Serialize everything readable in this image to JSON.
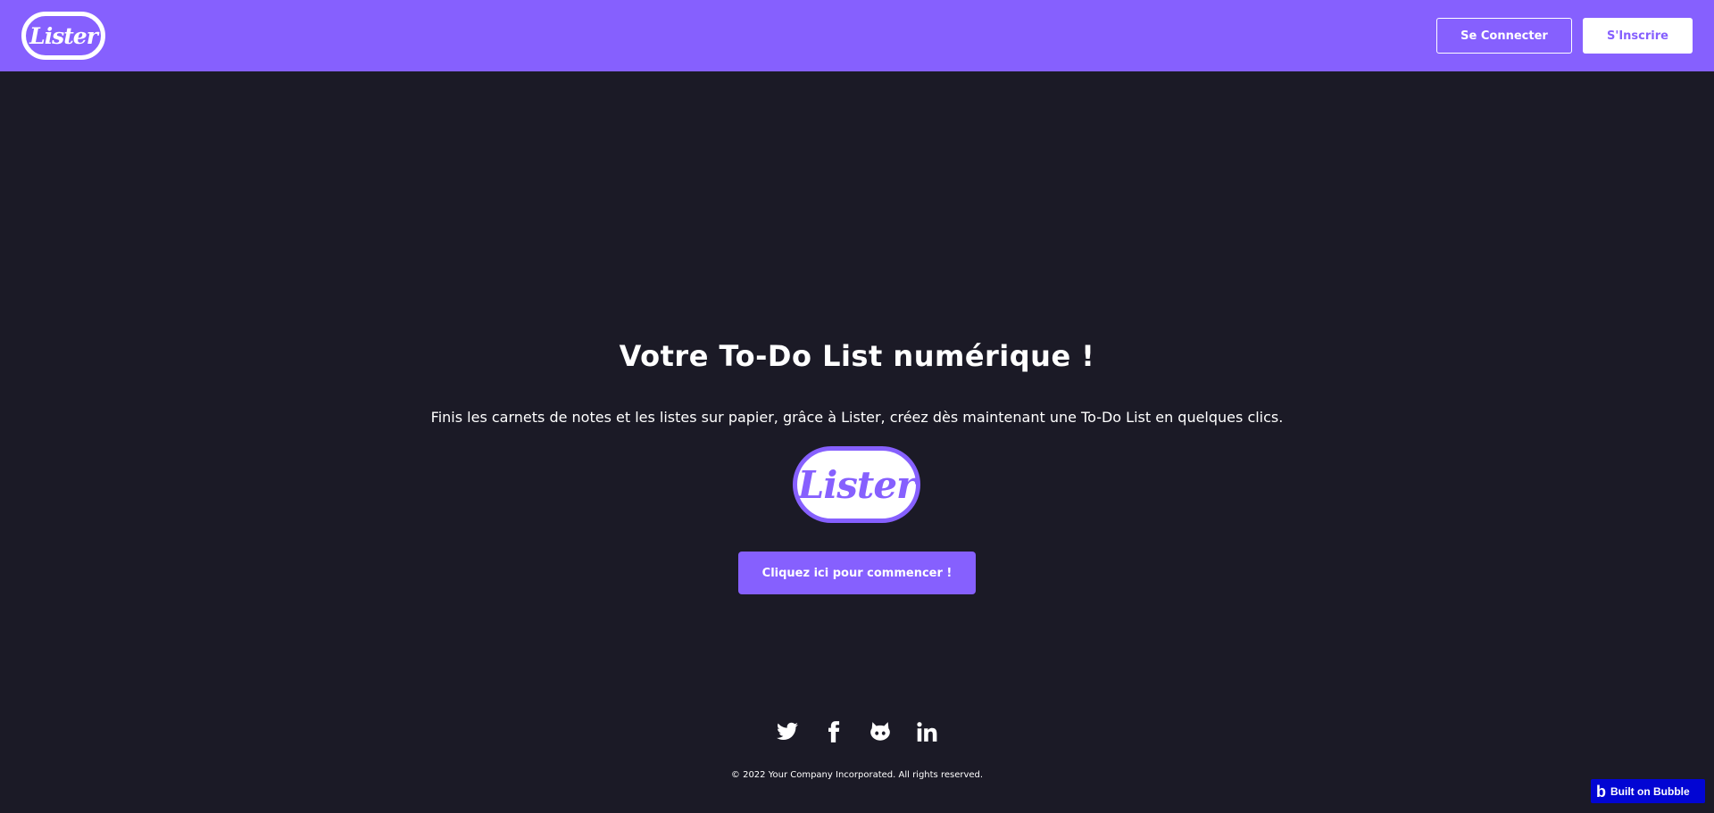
{
  "header": {
    "logo_text": "Lister",
    "login_label": "Se Connecter",
    "signup_label": "S'Inscrire"
  },
  "hero": {
    "title": "Votre To-Do List numérique !",
    "subtitle": "Finis les carnets de notes et les listes sur papier, grâce à Lister, créez dès maintenant une To-Do List en quelques clics.",
    "logo_text": "Lister",
    "cta_label": "Cliquez ici pour commencer !"
  },
  "footer": {
    "social_icons": [
      "twitter-icon",
      "facebook-icon",
      "github-icon",
      "linkedin-icon"
    ],
    "copyright": "© 2022 Your Company Incorporated. All rights reserved."
  },
  "badge": {
    "icon": "b",
    "label": "Built on Bubble"
  },
  "colors": {
    "brand_purple": "#8660fe",
    "background": "#1b1a26",
    "text": "#ffffff",
    "bubble_blue": "#0205d3"
  }
}
